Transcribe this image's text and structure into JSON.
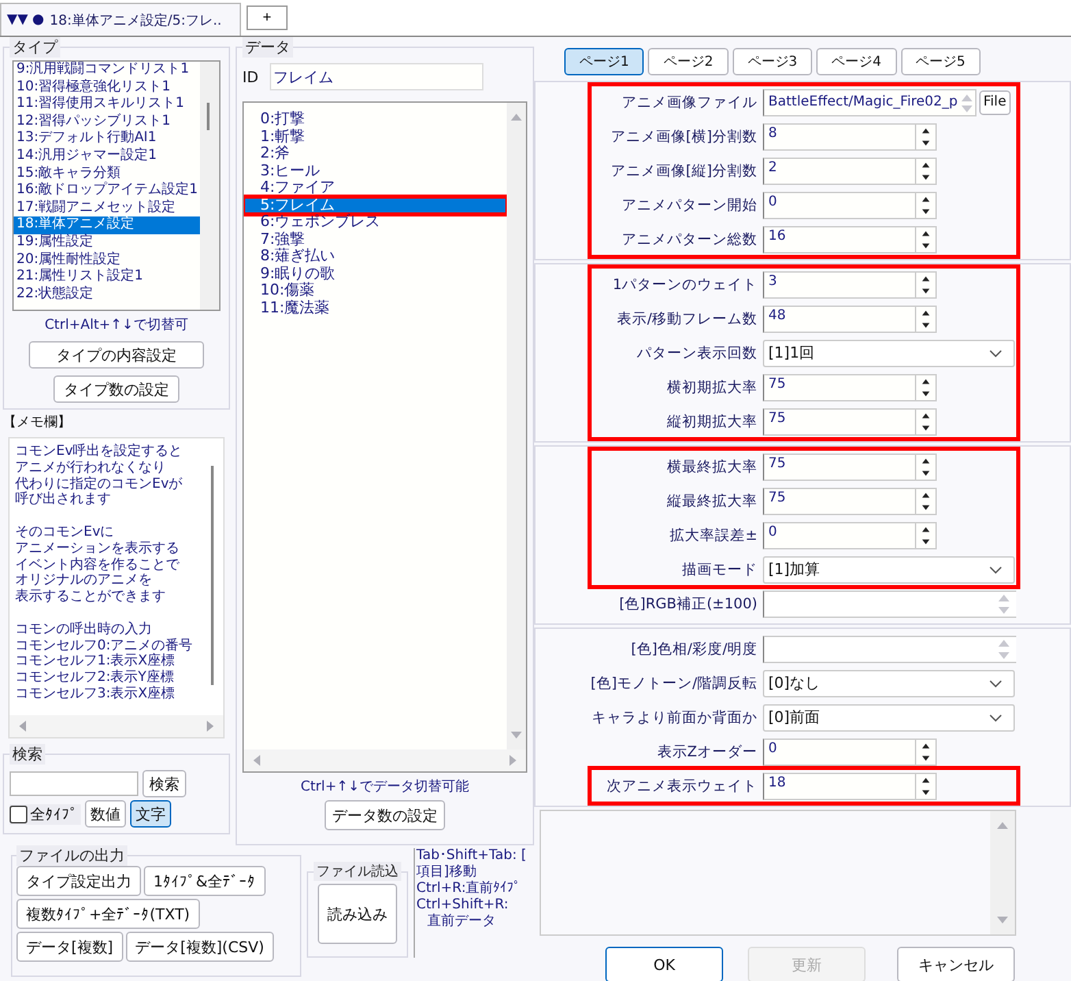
{
  "window": {
    "tab_icons": "▼▼ ●",
    "tab_title": "18:単体アニメ設定/5:フレ..",
    "new_tab": "+"
  },
  "type_panel": {
    "title": "タイプ",
    "items": [
      {
        "label": "9:汎用戦闘コマンドリスト1",
        "selected": false
      },
      {
        "label": "10:習得極意強化リスト1",
        "selected": false
      },
      {
        "label": "11:習得使用スキルリスト1",
        "selected": false
      },
      {
        "label": "12:習得パッシブリスト1",
        "selected": false
      },
      {
        "label": "13:デフォルト行動AI1",
        "selected": false
      },
      {
        "label": "14:汎用ジャマー設定1",
        "selected": false
      },
      {
        "label": "15:敵キャラ分類",
        "selected": false
      },
      {
        "label": "16:敵ドロップアイテム設定1",
        "selected": false
      },
      {
        "label": "17:戦闘アニメセット設定",
        "selected": false
      },
      {
        "label": "18:単体アニメ設定",
        "selected": true
      },
      {
        "label": "19:属性設定",
        "selected": false
      },
      {
        "label": "20:属性耐性設定",
        "selected": false
      },
      {
        "label": "21:属性リスト設定1",
        "selected": false
      },
      {
        "label": "22:状態設定",
        "selected": false
      }
    ],
    "hint": "Ctrl+Alt+↑↓で切替可",
    "buttons": [
      "タイプの内容設定",
      "タイプ数の設定"
    ]
  },
  "memo": {
    "title": "【メモ欄】",
    "paragraphs": [
      [
        "コモンEv呼出を設定すると",
        "アニメが行われなくなり",
        "代わりに指定のコモンEvが",
        "呼び出されます"
      ],
      [
        "そのコモンEvに",
        "アニメーションを表示する",
        "イベント内容を作ることで",
        "オリジナルのアニメを",
        "表示することができます"
      ],
      [
        "コモンの呼出時の入力",
        "コモンセルフ0:アニメの番号",
        "コモンセルフ1:表示X座標",
        "コモンセルフ2:表示Y座標",
        "コモンセルフ3:表示X座標"
      ]
    ]
  },
  "search": {
    "title": "検索",
    "button": "検索",
    "all_types": {
      "label": "全ﾀｲﾌﾟ",
      "checked": false
    },
    "modes": [
      {
        "label": "数値",
        "selected": false
      },
      {
        "label": "文字",
        "selected": true
      }
    ]
  },
  "data_panel": {
    "title": "データ",
    "id_label": "ID",
    "id_value": "フレイム",
    "items": [
      {
        "label": "0:打撃",
        "selected": false,
        "highlighted": false
      },
      {
        "label": "1:斬撃",
        "selected": false,
        "highlighted": false
      },
      {
        "label": "2:斧",
        "selected": false,
        "highlighted": false
      },
      {
        "label": "3:ヒール",
        "selected": false,
        "highlighted": false
      },
      {
        "label": "4:ファイア",
        "selected": false,
        "highlighted": false
      },
      {
        "label": "5:フレイム",
        "selected": true,
        "highlighted": true
      },
      {
        "label": "6:ウェポンブレス",
        "selected": false,
        "highlighted": false
      },
      {
        "label": "7:強撃",
        "selected": false,
        "highlighted": false
      },
      {
        "label": "8:薙ぎ払い",
        "selected": false,
        "highlighted": false
      },
      {
        "label": "9:眠りの歌",
        "selected": false,
        "highlighted": false
      },
      {
        "label": "10:傷薬",
        "selected": false,
        "highlighted": false
      },
      {
        "label": "11:魔法薬",
        "selected": false,
        "highlighted": false
      }
    ],
    "hint": "Ctrl+↑↓でデータ切替可能",
    "button": "データ数の設定"
  },
  "file_output": {
    "title": "ファイルの出力",
    "rows": [
      [
        "タイプ設定出力",
        "1ﾀｲﾌﾟ&全ﾃﾞｰﾀ"
      ],
      [
        "複数ﾀｲﾌﾟ+全ﾃﾞｰﾀ(TXT)"
      ],
      [
        "データ[複数]",
        "データ[複数](CSV)"
      ]
    ]
  },
  "file_load": {
    "title": "ファイル読込",
    "button": "読み込み"
  },
  "shortcuts": [
    "Tab･Shift+Tab: [",
    "項目]移動",
    "Ctrl+R:直前ﾀｲﾌﾟ",
    "Ctrl+Shift+R:",
    "直前データ"
  ],
  "pages": [
    {
      "label": "ページ1",
      "selected": true
    },
    {
      "label": "ページ2",
      "selected": false
    },
    {
      "label": "ページ3",
      "selected": false
    },
    {
      "label": "ページ4",
      "selected": false
    },
    {
      "label": "ページ5",
      "selected": false
    }
  ],
  "sections": [
    {
      "fields": [
        {
          "kind": "file",
          "label": "アニメ画像ファイル",
          "value": "BattleEffect/Magic_Fire02_p",
          "button": "File",
          "highlighted": true
        },
        {
          "kind": "spin",
          "label": "アニメ画像[横]分割数",
          "value": "8",
          "highlighted": true
        },
        {
          "kind": "spin",
          "label": "アニメ画像[縦]分割数",
          "value": "2",
          "highlighted": true
        },
        {
          "kind": "spin",
          "label": "アニメパターン開始",
          "value": "0",
          "highlighted": true
        },
        {
          "kind": "spin",
          "label": "アニメパターン総数",
          "value": "16",
          "highlighted": true
        }
      ]
    },
    {
      "fields": [
        {
          "kind": "spin",
          "label": "1パターンのウェイト",
          "value": "3",
          "highlighted": true
        },
        {
          "kind": "spin",
          "label": "表示/移動フレーム数",
          "value": "48",
          "highlighted": true
        },
        {
          "kind": "select",
          "label": "パターン表示回数",
          "value": "[1]1回",
          "highlighted": true
        },
        {
          "kind": "spin",
          "label": "横初期拡大率",
          "value": "75",
          "highlighted": true
        },
        {
          "kind": "spin",
          "label": "縦初期拡大率",
          "value": "75",
          "highlighted": true
        }
      ]
    },
    {
      "fields": [
        {
          "kind": "spin",
          "label": "横最終拡大率",
          "value": "75",
          "highlighted": true
        },
        {
          "kind": "spin",
          "label": "縦最終拡大率",
          "value": "75",
          "highlighted": true
        },
        {
          "kind": "spin",
          "label": "拡大率誤差±",
          "value": "0",
          "highlighted": true
        },
        {
          "kind": "select",
          "label": "描画モード",
          "value": "[1]加算",
          "highlighted": true
        },
        {
          "kind": "color",
          "label": "[色]RGB補正(±100)",
          "highlighted": false
        }
      ]
    },
    {
      "fields": [
        {
          "kind": "color",
          "label": "[色]色相/彩度/明度",
          "highlighted": false
        },
        {
          "kind": "select",
          "label": "[色]モノトーン/階調反転",
          "value": "[0]なし",
          "highlighted": false
        },
        {
          "kind": "select",
          "label": "キャラより前面か背面か",
          "value": "[0]前面",
          "highlighted": false
        },
        {
          "kind": "spin",
          "label": "表示Zオーダー",
          "value": "0",
          "highlighted": false
        },
        {
          "kind": "spin",
          "label": "次アニメ表示ウェイト",
          "value": "18",
          "highlighted": true
        }
      ]
    }
  ],
  "actions": [
    {
      "label": "OK",
      "disabled": false
    },
    {
      "label": "更新",
      "disabled": true
    },
    {
      "label": "キャンセル",
      "disabled": false
    }
  ]
}
